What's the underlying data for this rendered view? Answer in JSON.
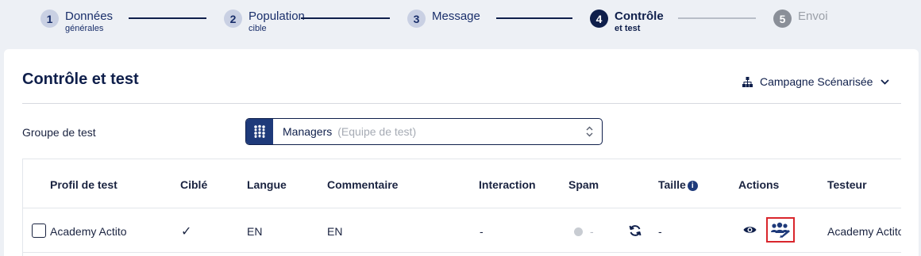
{
  "stepper": {
    "steps": [
      {
        "num": "1",
        "label": "Données",
        "sub": "générales"
      },
      {
        "num": "2",
        "label": "Population",
        "sub": "cible"
      },
      {
        "num": "3",
        "label": "Message",
        "sub": ""
      },
      {
        "num": "4",
        "label": "Contrôle",
        "sub": "et test"
      },
      {
        "num": "5",
        "label": "Envoi",
        "sub": ""
      }
    ]
  },
  "card": {
    "title": "Contrôle et test",
    "scenario_label": "Campagne Scénarisée"
  },
  "test_group": {
    "label": "Groupe de test",
    "value": "Managers",
    "sub": "(Equipe de test)"
  },
  "table": {
    "headers": [
      "Profil de test",
      "Ciblé",
      "Langue",
      "Commentaire",
      "Interaction",
      "Spam",
      "Taille",
      "Actions",
      "Testeur"
    ],
    "info_glyph": "i",
    "rows": [
      {
        "profile": "Academy Actito",
        "targeted": "✓",
        "language": "EN",
        "comment": "EN",
        "interaction": "-",
        "spam": "-",
        "size": "-",
        "tester": "Academy Actito"
      }
    ]
  },
  "icons": {
    "scenario": "sitemap-icon",
    "chevron": "chevron-down-icon",
    "group": "users-group-icon",
    "select_arrows": "up-down-arrows-icon",
    "refresh": "refresh-icon",
    "view": "eye-icon",
    "assign": "user-assign-icon"
  },
  "colors": {
    "primary": "#0f1f4b",
    "accent": "#1e3a7a",
    "highlight": "#d9262c"
  }
}
